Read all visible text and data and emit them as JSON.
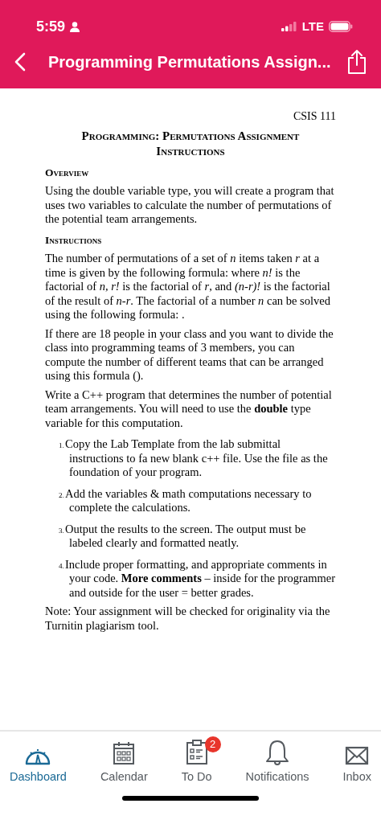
{
  "status_bar": {
    "time": "5:59",
    "network": "LTE"
  },
  "nav": {
    "title": "Programming Permutations Assign..."
  },
  "document": {
    "course": "CSIS 111",
    "title": "Programming: Permutations Assignment Instructions",
    "blocks": [
      {
        "kind": "heading",
        "text": "Overview"
      },
      {
        "kind": "paragraph",
        "text": "Using the double variable type, you will create a program that uses two variables to calculate the number of permutations of the potential team arrangements."
      },
      {
        "kind": "heading",
        "text": "Instructions"
      },
      {
        "kind": "paragraph",
        "text": "The number of permutations of a set of *n* items taken *r* at a time is given by the following formula: where *n!* is the factorial of *n*, *r!* is the factorial of *r*, and *(n-r)!* is the factorial of the result of *n-r*. The factorial of a number *n* can be solved using the following formula: ."
      },
      {
        "kind": "paragraph",
        "text": "If there are 18 people in your class and you want to divide the class into programming teams of 3 members, you can compute the number of different teams that can be arranged using this formula ()."
      },
      {
        "kind": "paragraph",
        "text": "Write a C++ program that determines the number of potential team arrangements. You will need to use the **double** type variable for this computation."
      },
      {
        "kind": "list_item",
        "number": "1.",
        "text": "Copy the Lab Template from the lab submittal instructions to fa new blank c++ file.  Use the file as the foundation of your program."
      },
      {
        "kind": "list_item",
        "number": "2.",
        "text": "Add the variables & math computations necessary to complete the calculations."
      },
      {
        "kind": "list_item",
        "number": "3.",
        "text": "Output the results to the screen. The output must be labeled clearly and formatted neatly."
      },
      {
        "kind": "list_item",
        "number": "4.",
        "text": "Include proper formatting, and appropriate comments in your code. **More comments** – inside for the programmer and outside for the user = better grades."
      },
      {
        "kind": "paragraph",
        "text": "Note: Your assignment will be checked for originality via the Turnitin plagiarism tool."
      }
    ]
  },
  "tabs": [
    {
      "kind": "dashboard",
      "label": "Dashboard",
      "selected": true
    },
    {
      "kind": "calendar",
      "label": "Calendar",
      "selected": false
    },
    {
      "kind": "todo",
      "label": "To Do",
      "selected": false,
      "badge": "2"
    },
    {
      "kind": "notifications",
      "label": "Notifications",
      "selected": false
    },
    {
      "kind": "inbox",
      "label": "Inbox",
      "selected": false
    }
  ]
}
